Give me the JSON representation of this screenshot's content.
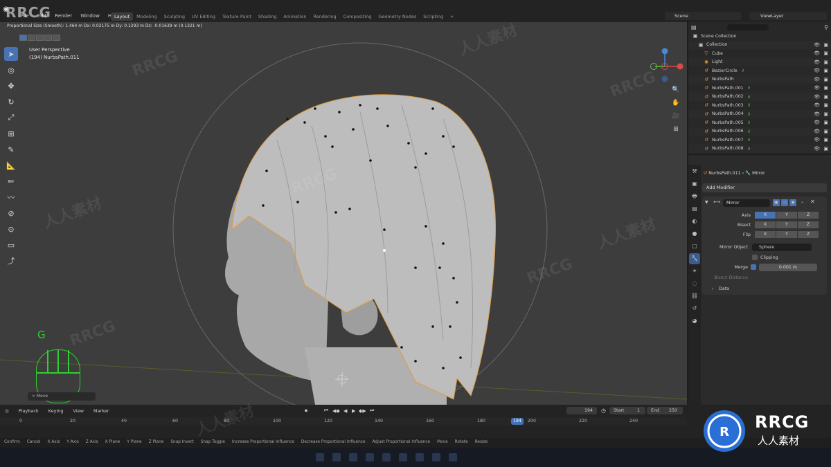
{
  "watermark": {
    "corner": "RRCG",
    "repeat": "RRCG",
    "cn": "人人素材",
    "brand": "RRCG",
    "brand_sub": "人人素材"
  },
  "menu": {
    "items": [
      "File",
      "Edit",
      "Render",
      "Window",
      "Help"
    ]
  },
  "workspaces": [
    "Layout",
    "Modeling",
    "Sculpting",
    "UV Editing",
    "Texture Paint",
    "Shading",
    "Animation",
    "Rendering",
    "Compositing",
    "Geometry Nodes",
    "Scripting",
    "+"
  ],
  "scene": "Scene",
  "view_layer": "ViewLayer",
  "viewport": {
    "header_info": "Proportional Size (Smooth): 1.464 m   Dx: 0.02175 m   Dy: 0.1293 m   Dz: -0.01639 m (0.1321 m)",
    "perspective": "User Perspective",
    "object": "(194) NurbsPath.011",
    "key_display": "G",
    "operator_panel": "> Move"
  },
  "outliner": {
    "root": "Scene Collection",
    "items": [
      {
        "name": "Collection",
        "icon": "collection-icon",
        "mod": ""
      },
      {
        "name": "Cube",
        "icon": "mesh-icon",
        "mod": ""
      },
      {
        "name": "Light",
        "icon": "light-icon",
        "mod": ""
      },
      {
        "name": "BezierCircle",
        "icon": "curve-icon",
        "mod": "∂"
      },
      {
        "name": "NurbsPath",
        "icon": "curve-icon",
        "mod": ""
      },
      {
        "name": "NurbsPath.001",
        "icon": "curve-icon",
        "mod": "∂"
      },
      {
        "name": "NurbsPath.002",
        "icon": "curve-icon",
        "mod": "∂"
      },
      {
        "name": "NurbsPath.003",
        "icon": "curve-icon",
        "mod": "∂"
      },
      {
        "name": "NurbsPath.004",
        "icon": "curve-icon",
        "mod": "∂"
      },
      {
        "name": "NurbsPath.005",
        "icon": "curve-icon",
        "mod": "∂"
      },
      {
        "name": "NurbsPath.006",
        "icon": "curve-icon",
        "mod": "∂"
      },
      {
        "name": "NurbsPath.007",
        "icon": "curve-icon",
        "mod": "∂"
      },
      {
        "name": "NurbsPath.008",
        "icon": "curve-icon",
        "mod": "∂"
      }
    ]
  },
  "properties": {
    "path_object": "NurbsPath.011",
    "path_modifier": "Mirror",
    "add_modifier": "Add Modifier",
    "modifier_name": "Mirror",
    "axis_label": "Axis",
    "bisect_label": "Bisect",
    "flip_label": "Flip",
    "axes": [
      "X",
      "Y",
      "Z"
    ],
    "mirror_object_label": "Mirror Object",
    "mirror_object": "Sphere",
    "clipping_label": "Clipping",
    "merge_label": "Merge",
    "merge_value": "0.001 m",
    "bisect_distance_label": "Bisect Distance",
    "data_label": "Data"
  },
  "timeline": {
    "menus": [
      "Playback",
      "Keying",
      "View",
      "Marker"
    ],
    "ticks": [
      "0",
      "20",
      "40",
      "60",
      "80",
      "100",
      "120",
      "140",
      "160",
      "180",
      "200",
      "220",
      "240"
    ],
    "current_frame": "194",
    "start_label": "Start",
    "start_value": "1",
    "end_label": "End",
    "end_value": "250"
  },
  "status": {
    "items": [
      "Confirm",
      "Cancel",
      "X Axis",
      "Y Axis",
      "Z Axis",
      "X Plane",
      "Y Plane",
      "Z Plane",
      "Snap Invert",
      "Snap Toggle",
      "Increase Proportional Influence",
      "Decrease Proportional Influence",
      "Adjust Proportional Influence",
      "Move",
      "Rotate",
      "Resize"
    ]
  }
}
